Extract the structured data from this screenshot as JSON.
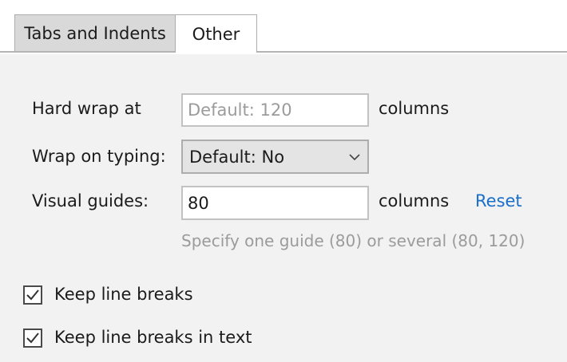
{
  "tabs": [
    {
      "label": "Tabs and Indents",
      "active": false
    },
    {
      "label": "Other",
      "active": true
    }
  ],
  "hard_wrap": {
    "label": "Hard wrap at",
    "placeholder": "Default: 120",
    "value": "",
    "suffix": "columns"
  },
  "wrap_on_typing": {
    "label": "Wrap on typing:",
    "selected": "Default: No"
  },
  "visual_guides": {
    "label": "Visual guides:",
    "value": "80",
    "suffix": "columns",
    "reset_label": "Reset",
    "hint": "Specify one guide (80) or several (80, 120)"
  },
  "checkboxes": [
    {
      "label": "Keep line breaks",
      "checked": true
    },
    {
      "label": "Keep line breaks in text",
      "checked": true
    }
  ],
  "colors": {
    "background": "#f2f2f2",
    "link": "#1a6fc9",
    "placeholder": "#9b9b9b"
  }
}
